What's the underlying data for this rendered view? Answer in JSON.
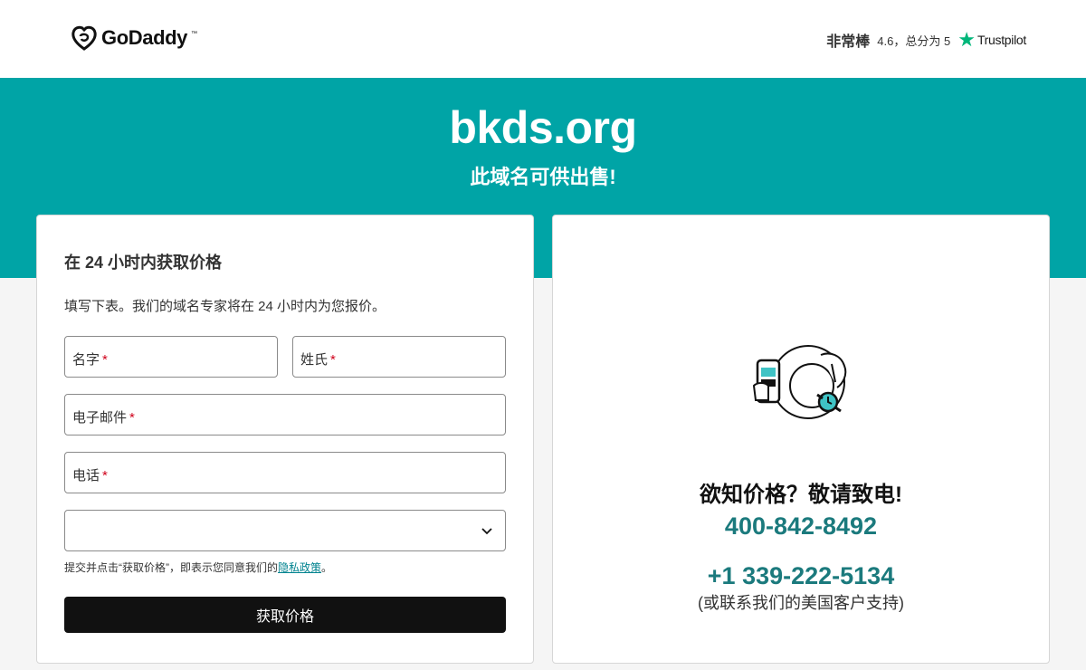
{
  "header": {
    "logo_text": "GoDaddy",
    "logo_tm": "™",
    "trust_grade": "非常棒",
    "trust_score": "4.6，总分为 5",
    "trust_brand": "Trustpilot"
  },
  "hero": {
    "domain": "bkds.org",
    "subtitle": "此域名可供出售!"
  },
  "form": {
    "title": "在 24 小时内获取价格",
    "description": "填写下表。我们的域名专家将在 24 小时内为您报价。",
    "first_name": "名字",
    "last_name": "姓氏",
    "email": "电子邮件",
    "phone": "电话",
    "required_mark": "*",
    "select_value": "",
    "consent_prefix": "提交并点击“获取价格”，即表示您同意我们的",
    "privacy_link": "隐私政策",
    "consent_suffix": "。",
    "submit_label": "获取价格"
  },
  "contact": {
    "title": "欲知价格？敬请致电!",
    "phone_cn": "400-842-8492",
    "phone_us": "+1 339-222-5134",
    "phone_us_note": "(或联系我们的美国客户支持)"
  },
  "colors": {
    "accent": "#00a4a6",
    "phone_text": "#1b7a7d",
    "trustpilot_star": "#00b67a",
    "button": "#111111"
  }
}
